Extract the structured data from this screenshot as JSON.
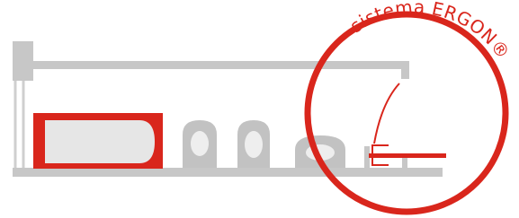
{
  "brand": {
    "text": "sistema ERGON®",
    "color": "#d9261c"
  },
  "colors": {
    "structure": "#c7c7c7",
    "structure_dark": "#b8b8b8",
    "fixture_fill": "#e6e6e6",
    "fixture_stroke": "#b5b5b5",
    "accent": "#d9261c",
    "background": "#ffffff"
  },
  "fixtures": [
    {
      "kind": "bathtub",
      "highlight": true
    },
    {
      "kind": "toilet"
    },
    {
      "kind": "bidet"
    },
    {
      "kind": "washbasin"
    }
  ],
  "icons": [
    "bathtub-icon",
    "toilet-icon",
    "bidet-icon",
    "washbasin-icon",
    "shower-drain-icon"
  ]
}
